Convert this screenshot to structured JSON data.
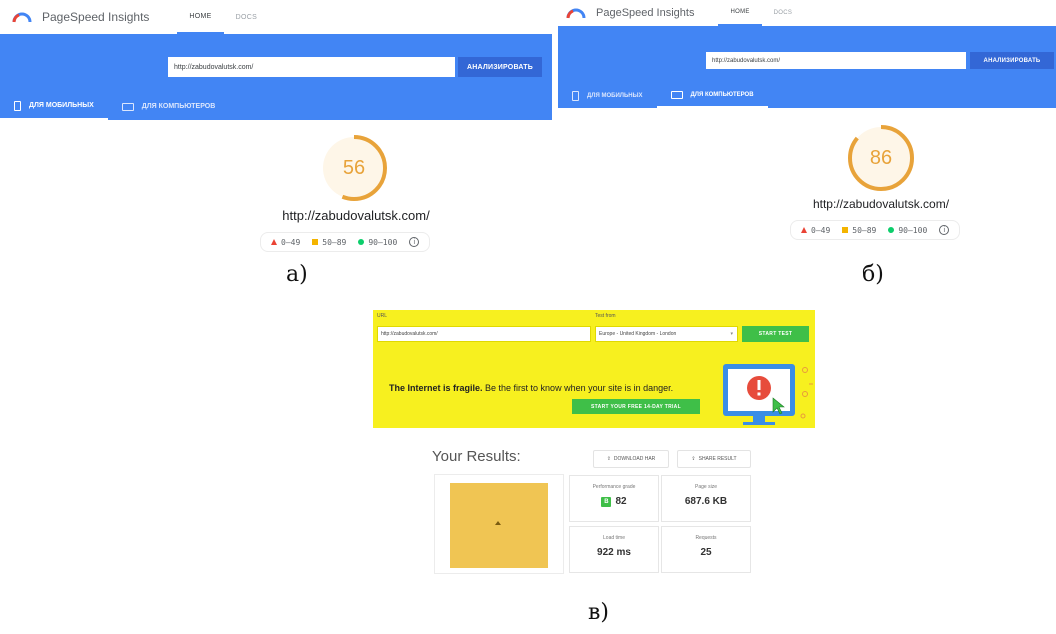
{
  "panel_a": {
    "app_title": "PageSpeed Insights",
    "nav": [
      "HOME",
      "DOCS"
    ],
    "url_value": "http://zabudovalutsk.com/",
    "analyze_label": "АНАЛИЗИРОВАТЬ",
    "tabs": [
      "ДЛЯ МОБИЛЬНЫХ",
      "ДЛЯ КОМПЬЮТЕРОВ"
    ],
    "active_tab": "ДЛЯ МОБИЛЬНЫХ",
    "score": "56",
    "score_fraction": 0.56,
    "site": "http://zabudovalutsk.com/",
    "legend": [
      "0–49",
      "50–89",
      "90–100"
    ],
    "caption": "а)"
  },
  "panel_b": {
    "app_title": "PageSpeed Insights",
    "nav": [
      "HOME",
      "DOCS"
    ],
    "url_value": "http://zabudovalutsk.com/",
    "analyze_label": "АНАЛИЗИРОВАТЬ",
    "tabs": [
      "ДЛЯ МОБИЛЬНЫХ",
      "ДЛЯ КОМПЬЮТЕРОВ"
    ],
    "active_tab": "ДЛЯ КОМПЬЮТЕРОВ",
    "score": "86",
    "score_fraction": 0.86,
    "site": "http://zabudovalutsk.com/",
    "legend": [
      "0–49",
      "50–89",
      "90–100"
    ],
    "caption": "б)"
  },
  "panel_c": {
    "url_label": "URL",
    "url_value": "http://zabudovalutsk.com/",
    "test_from_label": "Test from",
    "test_from_value": "Europe - United Kingdom - London",
    "start_test_label": "START TEST",
    "fragile_bold": "The Internet is fragile.",
    "fragile_rest": " Be the first to know when your site is in danger.",
    "trial_label": "START YOUR FREE 14-DAY TRIAL",
    "results_title": "Your Results:",
    "download_har": "DOWNLOAD HAR",
    "share_result": "SHARE RESULT",
    "cards": {
      "performance_label": "Performance grade",
      "performance_grade": "B",
      "performance_value": "82",
      "page_size_label": "Page size",
      "page_size_value": "687.6 KB",
      "load_time_label": "Load time",
      "load_time_value": "922 ms",
      "requests_label": "Requests",
      "requests_value": "25"
    },
    "caption": "в)"
  },
  "colors": {
    "google_blue": "#4285f4",
    "score_orange": "#e8a33a",
    "pingdom_yellow": "#f7f01f",
    "pingdom_green": "#3fbf48"
  }
}
